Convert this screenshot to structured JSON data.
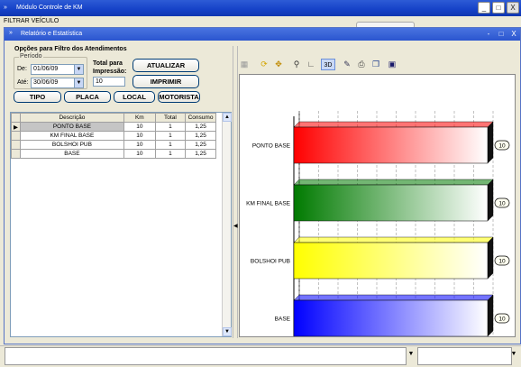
{
  "window": {
    "title": "Módulo Controle de KM",
    "minimize": "_",
    "maximize": "□",
    "close": "X"
  },
  "background_title": "FILTRAR VEÍCULO",
  "child": {
    "title": "Relatório e Estatística",
    "minimize": "-",
    "maximize": "□",
    "close": "X"
  },
  "filter": {
    "heading": "Opções para Filtro dos Atendimentos",
    "period_legend": "Período",
    "from_label": "De:",
    "from_value": "01/06/09",
    "to_label": "Até:",
    "to_value": "30/06/09",
    "total_label_1": "Total para",
    "total_label_2": "Impressão:",
    "total_value": "10",
    "update_button": "ATUALIZAR",
    "print_button": "IMPRIMIR",
    "tipo_button": "TIPO",
    "placa_button": "PLACA",
    "local_button": "LOCAL",
    "motorista_button": "MOTORISTA"
  },
  "grid": {
    "headers": [
      "Descrição",
      "Km",
      "Total",
      "Consumo"
    ],
    "rows": [
      [
        "PONTO BASE",
        "10",
        "1",
        "1,25"
      ],
      [
        "KM FINAL BASE",
        "10",
        "1",
        "1,25"
      ],
      [
        "BOLSHOI PUB",
        "10",
        "1",
        "1,25"
      ],
      [
        "BASE",
        "10",
        "1",
        "1,25"
      ]
    ]
  },
  "toolbar_icons": [
    "grid-toggle-icon",
    "rotate-icon",
    "move-icon",
    "zoom-icon",
    "axis-icon",
    "3d-toggle-icon",
    "edit-icon",
    "print-icon",
    "copy-icon",
    "save-icon"
  ],
  "toolbar_3d_label": "3D",
  "chart_data": {
    "type": "bar",
    "orientation": "horizontal",
    "categories": [
      "PONTO BASE",
      "KM FINAL BASE",
      "BOLSHOI PUB",
      "BASE"
    ],
    "values": [
      10,
      10,
      10,
      10
    ],
    "data_labels": [
      "10",
      "10",
      "10",
      "10"
    ],
    "colors": [
      "#ff0000",
      "#007a00",
      "#ffff00",
      "#0000ff"
    ],
    "xlim": [
      0,
      10
    ],
    "xticks": [
      "0",
      "1",
      "2",
      "3",
      "4",
      "5",
      "6",
      "7",
      "8",
      "9",
      "10"
    ],
    "grid": true,
    "style": "3d-gradient"
  }
}
